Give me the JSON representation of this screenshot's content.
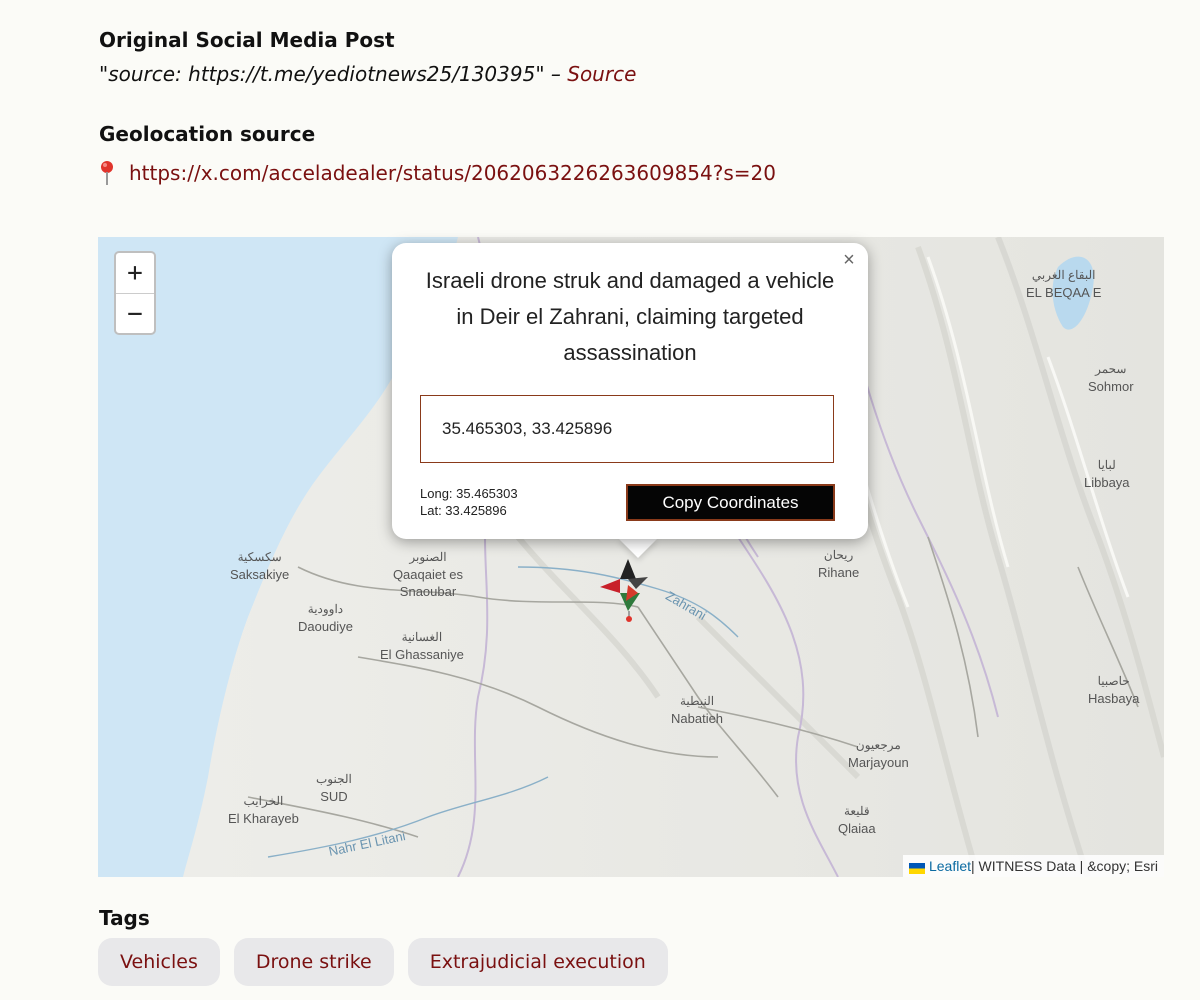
{
  "post": {
    "heading": "Original Social Media Post",
    "quote": "\"source: https://t.me/yediotnews25/130395\" – ",
    "source_label": "Source"
  },
  "geolocation": {
    "heading": "Geolocation source",
    "url": "https://x.com/acceladealer/status/2062063226263609854?s=20"
  },
  "map": {
    "zoom_in": "+",
    "zoom_out": "−",
    "places": [
      {
        "ar": "سكسكية",
        "en": "Saksakiye"
      },
      {
        "ar": "الصنوبر",
        "en": "Qaaqaiet es Snaoubar"
      },
      {
        "ar": "داوودية",
        "en": "Daoudiye"
      },
      {
        "ar": "الغسانية",
        "en": "El Ghassaniye"
      },
      {
        "ar": "النبطية",
        "en": "Nabatieh"
      },
      {
        "ar": "ريحان",
        "en": "Rihane"
      },
      {
        "ar": "سحمر",
        "en": "Sohmor"
      },
      {
        "ar": "لبايا",
        "en": "Libbaya"
      },
      {
        "ar": "حاصبيا",
        "en": "Hasbaya"
      },
      {
        "ar": "مرجعيون",
        "en": "Marjayoun"
      },
      {
        "ar": "قليعة",
        "en": "Qlaiaa"
      },
      {
        "ar": "الخرايب",
        "en": "El Kharayeb"
      },
      {
        "ar": "الجنوب",
        "en": "SUD"
      },
      {
        "ar": "البقاع الغربي",
        "en": "EL BEQAA E"
      },
      {
        "ar": "",
        "en": "Nahr El Litani"
      },
      {
        "ar": "",
        "en": "Zahrani"
      }
    ],
    "attribution": {
      "leaflet": "Leaflet",
      "rest": " | WITNESS Data | &copy; Esri"
    }
  },
  "popup": {
    "close": "×",
    "title": "Israeli drone struk and damaged a vehicle in Deir el Zahrani, claiming targeted assassination",
    "coordinates": "35.465303, 33.425896",
    "long_label": "Long: 35.465303",
    "lat_label": "Lat: 33.425896",
    "copy_button": "Copy Coordinates"
  },
  "tags": {
    "heading": "Tags",
    "items": [
      "Vehicles",
      "Drone strike",
      "Extrajudicial execution"
    ]
  },
  "colors": {
    "link": "#7a1010",
    "sea": "#cfe6f5",
    "tag_bg": "#e8e8ea"
  }
}
